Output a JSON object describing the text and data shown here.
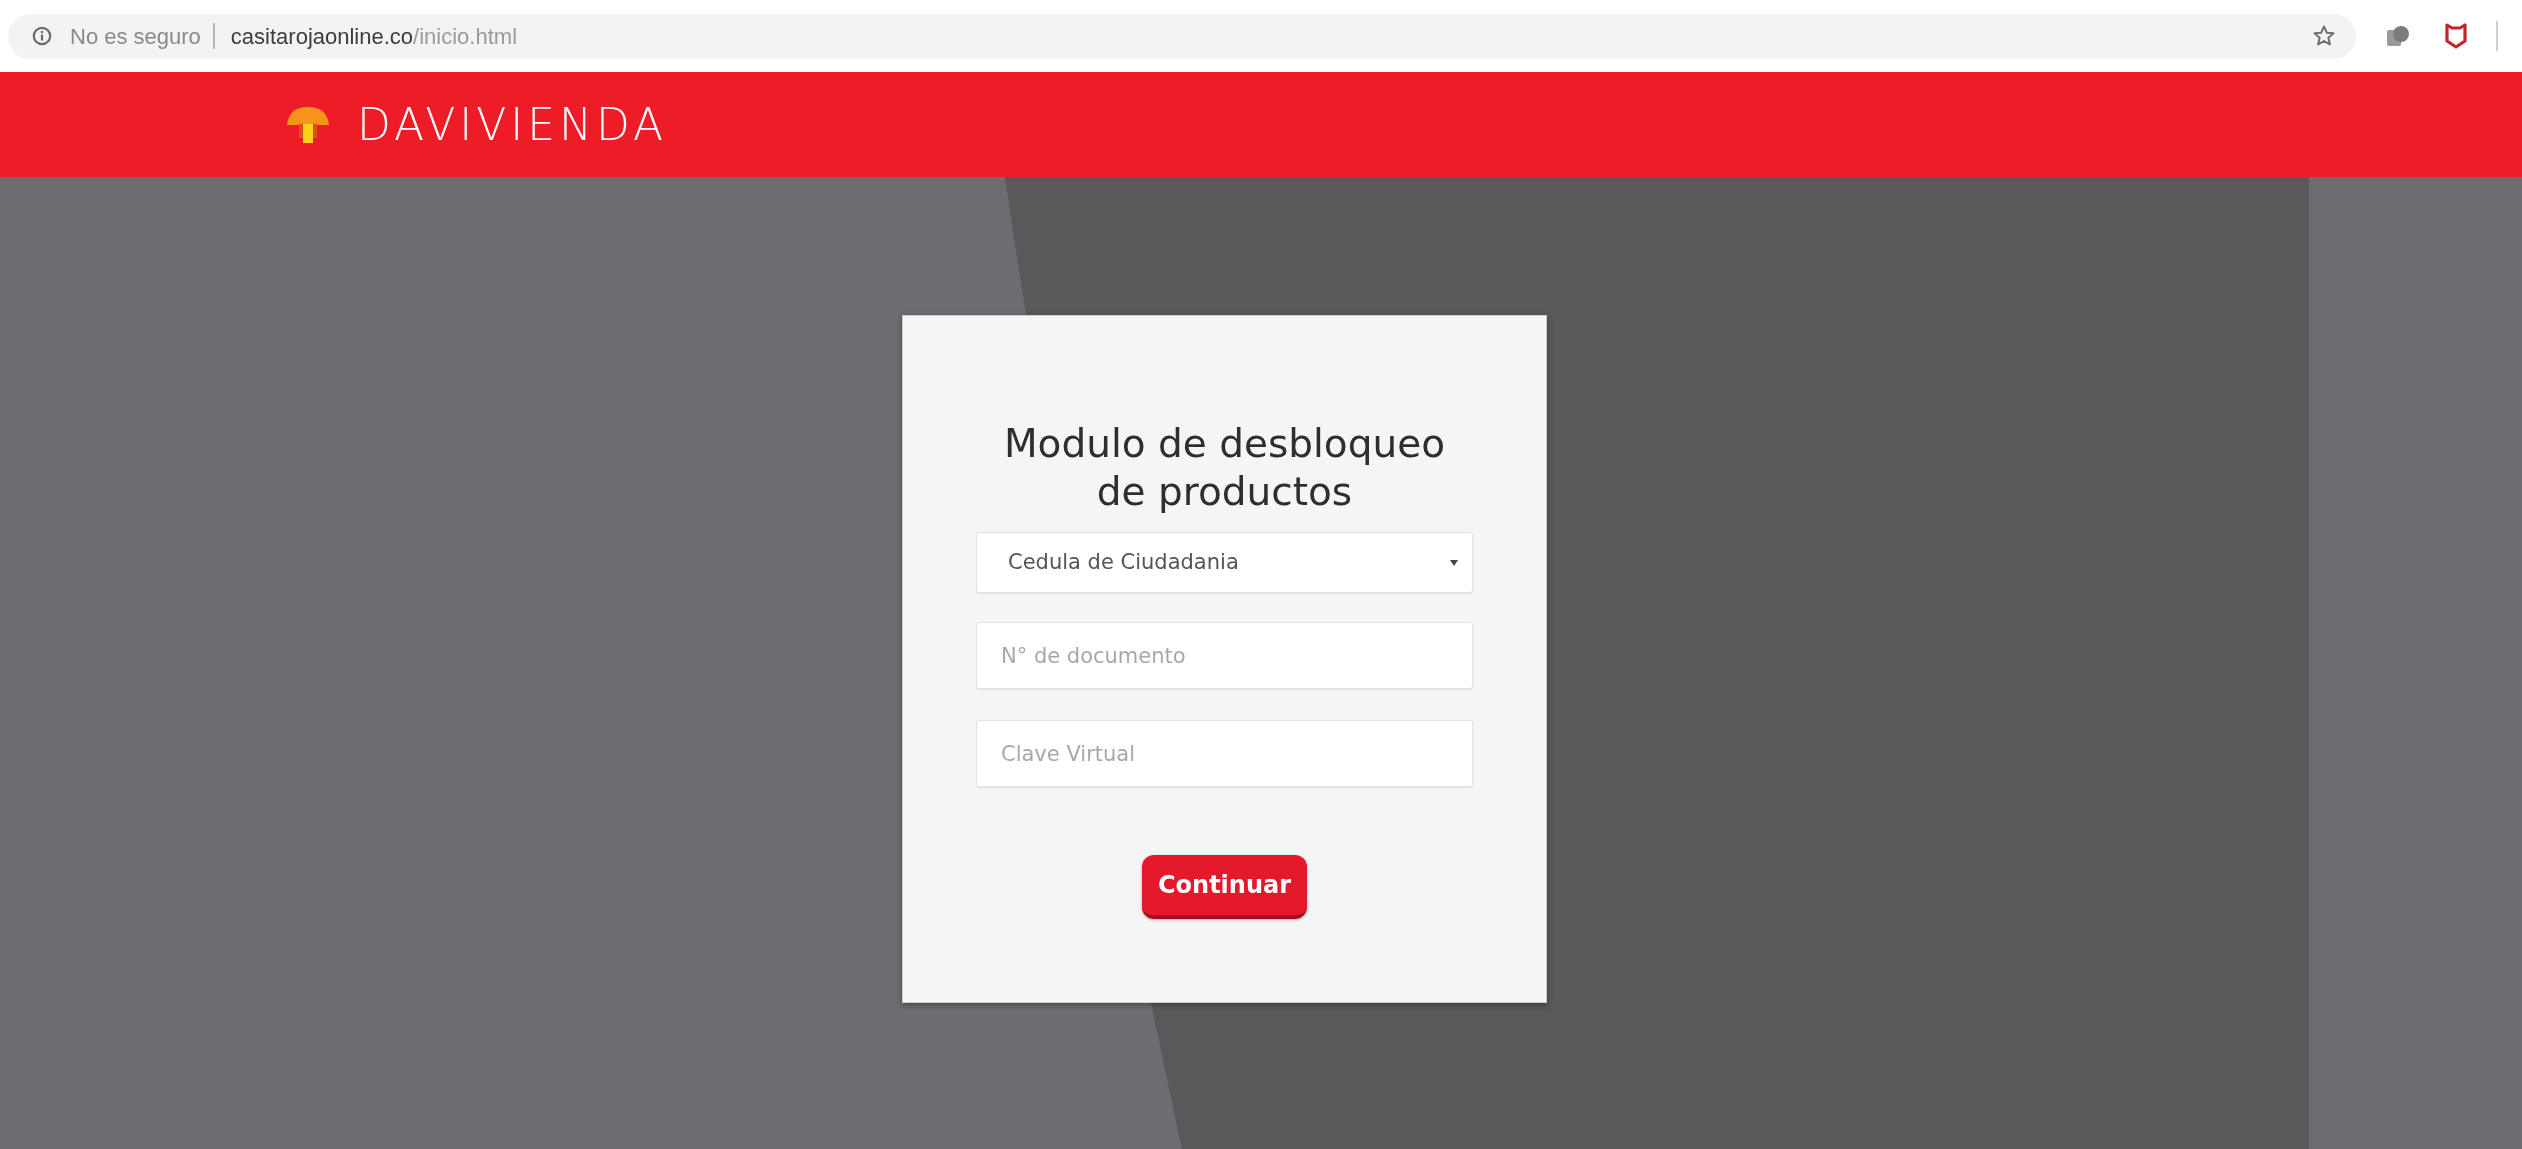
{
  "browser": {
    "security_label": "No es seguro",
    "url": {
      "host": "casitarojaonline.co",
      "path": "/inicio.html"
    }
  },
  "header": {
    "logo_text": "DAVIVIENDA"
  },
  "form": {
    "title": "Modulo de desbloqueo de productos",
    "document_type": {
      "value": "Cedula de Ciudadania"
    },
    "fields": [
      {
        "placeholder": "N° de documento"
      },
      {
        "placeholder": "Clave Virtual"
      }
    ],
    "submit_button": "Continuar"
  }
}
